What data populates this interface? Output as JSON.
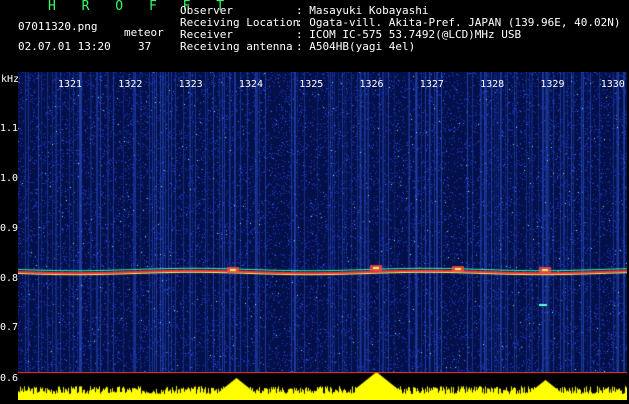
{
  "header": {
    "brand": "H R O F F T",
    "filename": "07011320.png",
    "timestamp": "02.07.01 13:20",
    "meteor_label": "meteor",
    "meteor_count": "37",
    "observer_label": "Observer",
    "observer_value": ": Masayuki Kobayashi",
    "location_label": "Receiving Location",
    "location_value": ": Ogata-vill. Akita-Pref. JAPAN (139.96E, 40.02N)",
    "receiver_label": "Receiver",
    "receiver_value": ": ICOM IC-575 53.7492(@LCD)MHz USB",
    "antenna_label": "Receiving antenna",
    "antenna_value": ": A504HB(yagi 4el)"
  },
  "axis": {
    "unit": "kHz",
    "y_ticks": [
      "1.1",
      "1.0",
      "0.9",
      "0.8",
      "0.7",
      "0.6"
    ],
    "x_ticks": [
      "1321",
      "1322",
      "1323",
      "1324",
      "1325",
      "1326",
      "1327",
      "1328",
      "1329",
      "1330"
    ]
  },
  "colors": {
    "brand": "#33ff66",
    "background": "#000000",
    "noise_floor": "#061060",
    "signal_band": "#ff3030",
    "level_bar": "#ffff00"
  }
}
